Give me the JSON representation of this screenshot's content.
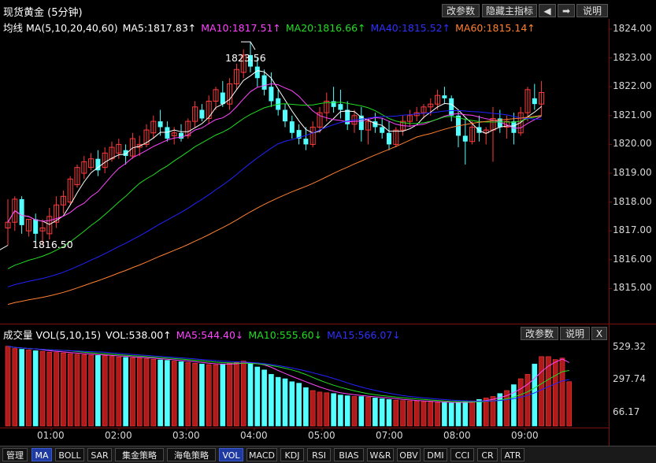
{
  "header": {
    "title": "现货黄金 (5分钟)",
    "buttons": [
      "改参数",
      "隐藏主指标",
      "说明"
    ],
    "nav_left": "◀",
    "nav_right": "➡"
  },
  "price_legend": {
    "prefix": "均线",
    "ma": "MA(5,10,20,40,60)",
    "ma5": "MA5:1817.83↑",
    "ma10": "MA10:1817.51↑",
    "ma20": "MA20:1816.66↑",
    "ma40": "MA40:1815.52↑",
    "ma60": "MA60:1815.14↑"
  },
  "annotations": {
    "high": "1823.56",
    "low": "1816.50"
  },
  "price_axis": [
    "1824.00",
    "1823.00",
    "1822.00",
    "1821.00",
    "1820.00",
    "1819.00",
    "1818.00",
    "1817.00",
    "1816.00",
    "1815.00"
  ],
  "volume_panel": {
    "name": "成交量",
    "vol": "VOL(5,10,15)",
    "vol_value": "VOL:538.00↑",
    "ma5": "MA5:544.40↓",
    "ma10": "MA10:555.60↓",
    "ma15": "MA15:566.07↓",
    "buttons": [
      "改参数",
      "说明"
    ],
    "close": "X",
    "axis": [
      "529.32",
      "297.74",
      "66.17"
    ]
  },
  "time_axis": [
    "01:00",
    "02:00",
    "03:00",
    "04:00",
    "05:00",
    "07:00",
    "08:00",
    "09:00"
  ],
  "tabs": [
    "管理",
    "MA",
    "BOLL",
    "SAR",
    "集金策略",
    "海龟策略",
    "VOL",
    "MACD",
    "KDJ",
    "RSI",
    "BIAS",
    "W&R",
    "OBV",
    "DMI",
    "CCI",
    "CR",
    "ATR"
  ],
  "active_tabs": [
    "MA",
    "VOL"
  ],
  "colors": {
    "up": "#ff3b3b",
    "down": "#54ffff",
    "ma5": "#ffffff",
    "ma10": "#ff44ff",
    "ma20": "#22dd22",
    "ma40": "#2222ff",
    "ma60": "#ff8030",
    "separator": "#7a1010"
  },
  "chart_data": {
    "type": "candlestick",
    "ylim": [
      1814.2,
      1824.6
    ],
    "volume_ylim": [
      0,
      560
    ],
    "candles": [
      [
        1817.1,
        1818.1,
        1816.5,
        1817.3
      ],
      [
        1817.3,
        1818.2,
        1817.0,
        1818.1
      ],
      [
        1818.1,
        1818.2,
        1816.9,
        1817.2
      ],
      [
        1817.0,
        1817.4,
        1816.8,
        1817.4
      ],
      [
        1817.4,
        1817.6,
        1816.6,
        1816.9
      ],
      [
        1817.0,
        1817.4,
        1816.5,
        1817.1
      ],
      [
        1816.9,
        1817.8,
        1816.7,
        1817.5
      ],
      [
        1817.3,
        1818.2,
        1817.1,
        1817.9
      ],
      [
        1817.9,
        1818.4,
        1817.6,
        1818.2
      ],
      [
        1818.0,
        1818.9,
        1817.9,
        1818.8
      ],
      [
        1818.6,
        1819.3,
        1818.5,
        1819.2
      ],
      [
        1819.0,
        1819.6,
        1818.8,
        1819.4
      ],
      [
        1819.2,
        1819.7,
        1819.1,
        1819.5
      ],
      [
        1819.5,
        1819.8,
        1818.9,
        1819.1
      ],
      [
        1819.2,
        1819.9,
        1819.0,
        1819.7
      ],
      [
        1819.5,
        1820.1,
        1819.4,
        1819.9
      ],
      [
        1819.7,
        1820.2,
        1819.5,
        1820.0
      ],
      [
        1819.8,
        1820.0,
        1819.3,
        1819.6
      ],
      [
        1819.6,
        1820.4,
        1819.5,
        1820.2
      ],
      [
        1819.9,
        1820.3,
        1819.6,
        1820.0
      ],
      [
        1820.0,
        1820.7,
        1819.9,
        1820.5
      ],
      [
        1820.4,
        1821.0,
        1820.2,
        1820.8
      ],
      [
        1820.8,
        1821.2,
        1820.3,
        1820.6
      ],
      [
        1820.6,
        1820.8,
        1820.1,
        1820.2
      ],
      [
        1820.3,
        1820.6,
        1820.0,
        1820.4
      ],
      [
        1820.4,
        1820.7,
        1820.1,
        1820.2
      ],
      [
        1820.3,
        1820.9,
        1820.2,
        1820.8
      ],
      [
        1820.8,
        1821.5,
        1820.6,
        1821.3
      ],
      [
        1821.2,
        1821.4,
        1820.8,
        1820.9
      ],
      [
        1820.9,
        1821.7,
        1820.7,
        1821.5
      ],
      [
        1821.5,
        1822.0,
        1821.2,
        1821.9
      ],
      [
        1821.8,
        1822.2,
        1821.3,
        1821.4
      ],
      [
        1821.4,
        1822.3,
        1821.2,
        1822.1
      ],
      [
        1822.1,
        1822.8,
        1821.9,
        1822.6
      ],
      [
        1822.5,
        1823.3,
        1822.3,
        1823.1
      ],
      [
        1823.1,
        1823.56,
        1822.5,
        1822.7
      ],
      [
        1822.7,
        1823.0,
        1822.0,
        1822.3
      ],
      [
        1822.4,
        1822.6,
        1821.7,
        1821.9
      ],
      [
        1822.0,
        1822.5,
        1821.3,
        1821.5
      ],
      [
        1821.6,
        1821.9,
        1821.0,
        1821.2
      ],
      [
        1821.2,
        1821.4,
        1820.6,
        1820.8
      ],
      [
        1820.8,
        1821.0,
        1820.2,
        1820.4
      ],
      [
        1820.5,
        1820.7,
        1820.0,
        1820.2
      ],
      [
        1820.2,
        1820.6,
        1819.8,
        1820.0
      ],
      [
        1820.0,
        1820.8,
        1819.9,
        1820.6
      ],
      [
        1820.6,
        1821.3,
        1820.4,
        1821.1
      ],
      [
        1821.1,
        1821.8,
        1820.8,
        1821.5
      ],
      [
        1821.5,
        1822.0,
        1821.1,
        1821.3
      ],
      [
        1821.4,
        1821.9,
        1820.9,
        1821.2
      ],
      [
        1821.2,
        1821.5,
        1820.5,
        1820.7
      ],
      [
        1820.7,
        1821.2,
        1820.4,
        1821.0
      ],
      [
        1821.0,
        1821.3,
        1820.1,
        1820.5
      ],
      [
        1820.5,
        1820.9,
        1820.0,
        1820.8
      ],
      [
        1820.8,
        1821.1,
        1820.4,
        1820.6
      ],
      [
        1820.6,
        1820.9,
        1820.2,
        1820.4
      ],
      [
        1820.4,
        1820.8,
        1819.8,
        1820.0
      ],
      [
        1820.0,
        1820.6,
        1819.9,
        1820.5
      ],
      [
        1820.5,
        1821.0,
        1820.3,
        1820.8
      ],
      [
        1820.8,
        1821.2,
        1820.6,
        1821.0
      ],
      [
        1821.0,
        1821.3,
        1820.8,
        1821.1
      ],
      [
        1821.1,
        1821.4,
        1820.9,
        1821.3
      ],
      [
        1821.3,
        1821.6,
        1821.0,
        1821.4
      ],
      [
        1821.4,
        1821.9,
        1821.2,
        1821.7
      ],
      [
        1821.7,
        1822.0,
        1821.4,
        1821.6
      ],
      [
        1821.6,
        1821.7,
        1820.8,
        1821.0
      ],
      [
        1821.0,
        1821.2,
        1819.9,
        1820.3
      ],
      [
        1820.3,
        1820.9,
        1819.3,
        1820.1
      ],
      [
        1820.1,
        1820.8,
        1820.0,
        1820.6
      ],
      [
        1820.6,
        1821.0,
        1820.1,
        1820.4
      ],
      [
        1820.4,
        1820.6,
        1820.0,
        1820.5
      ],
      [
        1820.5,
        1821.3,
        1819.4,
        1820.9
      ],
      [
        1820.9,
        1821.2,
        1820.4,
        1820.6
      ],
      [
        1820.6,
        1821.0,
        1820.2,
        1820.8
      ],
      [
        1820.8,
        1821.1,
        1820.0,
        1820.4
      ],
      [
        1820.4,
        1821.3,
        1820.3,
        1821.1
      ],
      [
        1821.1,
        1822.0,
        1820.8,
        1821.9
      ],
      [
        1821.6,
        1822.1,
        1821.2,
        1821.4
      ],
      [
        1821.4,
        1822.2,
        1821.0,
        1821.8
      ]
    ],
    "volume": [
      540,
      525,
      520,
      515,
      510,
      505,
      500,
      498,
      495,
      490,
      486,
      483,
      480,
      478,
      476,
      472,
      468,
      465,
      462,
      460,
      456,
      452,
      448,
      445,
      440,
      436,
      430,
      425,
      420,
      416,
      415,
      420,
      425,
      430,
      440,
      420,
      400,
      380,
      350,
      330,
      320,
      300,
      290,
      260,
      240,
      230,
      225,
      220,
      210,
      205,
      200,
      200,
      195,
      190,
      185,
      180,
      175,
      172,
      170,
      168,
      165,
      162,
      160,
      158,
      156,
      160,
      165,
      170,
      180,
      190,
      200,
      220,
      240,
      280,
      320,
      350,
      420,
      470,
      470,
      450,
      460,
      300
    ]
  }
}
